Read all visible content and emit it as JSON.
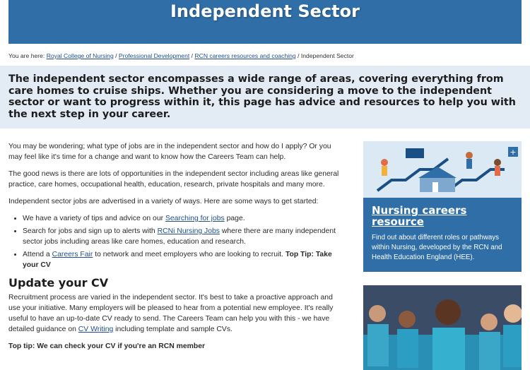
{
  "hero": {
    "title": "Independent Sector"
  },
  "breadcrumb": {
    "prefix": "You are here:",
    "links": [
      "Royal College of Nursing",
      "Professional Development",
      "RCN careers resources and coaching"
    ],
    "current": "Independent Sector"
  },
  "intro": "The independent sector encompasses a wide range of areas, covering everything from care homes to cruise ships. Whether you are considering a move to the independent sector or want to progress within it, this page has advice and resources to help you with the next step in your career.",
  "body": {
    "p1": "You may be wondering; what type of jobs are in the independent sector and how do I apply? Or you may feel like it's time for a change and want to know how the Careers Team can help.",
    "p2": "The good news is there are lots of opportunities in the independent sector including areas like general practice, care homes, occupational health, education, research, private hospitals and many more.",
    "p3": "Independent sector jobs are advertised in a variety of ways. Here are some ways to get started:",
    "list": {
      "i1_pre": "We have a variety of tips and advice on our ",
      "i1_link": "Searching for jobs",
      "i1_post": " page.",
      "i2_pre": "Search for jobs and sign up to alerts with ",
      "i2_link": "RCNi Nursing Jobs",
      "i2_post": " where there are many independent sector jobs including areas like care homes, education and research.",
      "i3_pre": "Attend a ",
      "i3_link": "Careers Fair",
      "i3_post": " to network and meet employers who are looking to recruit. ",
      "i3_bold": "Top Tip: Take your CV"
    },
    "h2": "Update your CV",
    "p4_pre": "Recruitment process are varied in the independent sector. It's best to take a proactive approach and use your initiative. Many employers will be pleased to hear from a potential new employee. It's really useful to have an up-to-date CV ready to send. The Careers Team can help you with this - we have detailed guidance on ",
    "p4_link": "CV Writing",
    "p4_post": " including template and sample CVs.",
    "toptip": "Top tip: We can check your CV if you're an RCN member"
  },
  "sidebar": {
    "card1": {
      "title": "Nursing careers resource",
      "desc": "Find out about different roles or pathways within Nursing, developed by the RCN and Health Education England (HEE).",
      "image_icon": "careers-illustration"
    },
    "card2": {
      "image_icon": "nursing-students-photo"
    }
  },
  "colors": {
    "brand": "#2f6ea7",
    "band": "#e3ecf5",
    "link": "#1f4e8c"
  }
}
